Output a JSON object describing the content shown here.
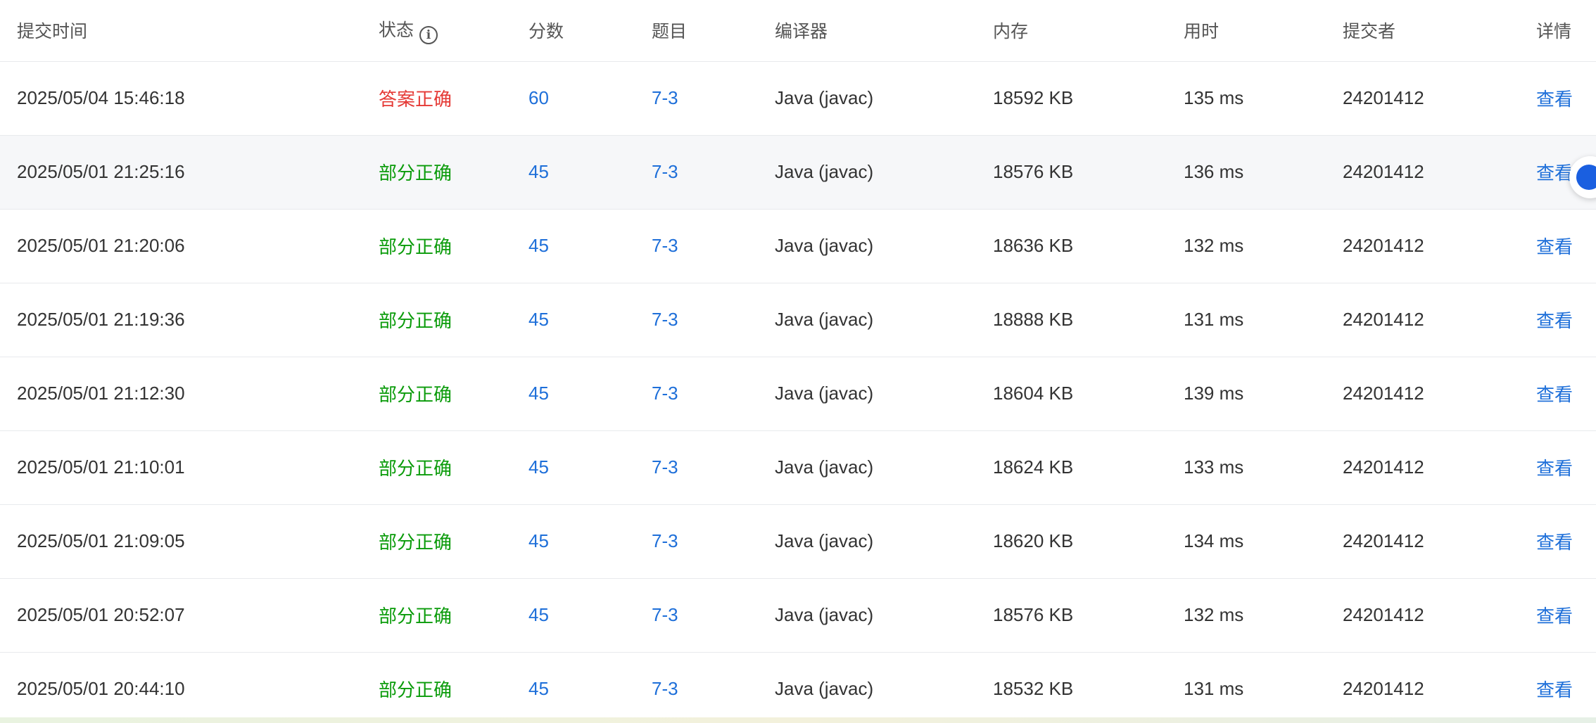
{
  "columns": {
    "time": "提交时间",
    "status": "状态",
    "score": "分数",
    "problem": "题目",
    "compiler": "编译器",
    "memory": "内存",
    "time_used": "用时",
    "submitter": "提交者",
    "detail": "详情"
  },
  "status_info_icon": "info-icon",
  "colors": {
    "accepted": "#e53935",
    "partial": "#0a9b0a",
    "link": "#1e6fd9",
    "floating_button": "#1a5fe0"
  },
  "rows": [
    {
      "time": "2025/05/04 15:46:18",
      "status": "答案正确",
      "status_type": "accepted",
      "score": "60",
      "problem": "7-3",
      "compiler": "Java (javac)",
      "memory": "18592 KB",
      "time_used": "135 ms",
      "submitter": "24201412",
      "detail": "查看"
    },
    {
      "time": "2025/05/01 21:25:16",
      "status": "部分正确",
      "status_type": "partial",
      "score": "45",
      "problem": "7-3",
      "compiler": "Java (javac)",
      "memory": "18576 KB",
      "time_used": "136 ms",
      "submitter": "24201412",
      "detail": "查看"
    },
    {
      "time": "2025/05/01 21:20:06",
      "status": "部分正确",
      "status_type": "partial",
      "score": "45",
      "problem": "7-3",
      "compiler": "Java (javac)",
      "memory": "18636 KB",
      "time_used": "132 ms",
      "submitter": "24201412",
      "detail": "查看"
    },
    {
      "time": "2025/05/01 21:19:36",
      "status": "部分正确",
      "status_type": "partial",
      "score": "45",
      "problem": "7-3",
      "compiler": "Java (javac)",
      "memory": "18888 KB",
      "time_used": "131 ms",
      "submitter": "24201412",
      "detail": "查看"
    },
    {
      "time": "2025/05/01 21:12:30",
      "status": "部分正确",
      "status_type": "partial",
      "score": "45",
      "problem": "7-3",
      "compiler": "Java (javac)",
      "memory": "18604 KB",
      "time_used": "139 ms",
      "submitter": "24201412",
      "detail": "查看"
    },
    {
      "time": "2025/05/01 21:10:01",
      "status": "部分正确",
      "status_type": "partial",
      "score": "45",
      "problem": "7-3",
      "compiler": "Java (javac)",
      "memory": "18624 KB",
      "time_used": "133 ms",
      "submitter": "24201412",
      "detail": "查看"
    },
    {
      "time": "2025/05/01 21:09:05",
      "status": "部分正确",
      "status_type": "partial",
      "score": "45",
      "problem": "7-3",
      "compiler": "Java (javac)",
      "memory": "18620 KB",
      "time_used": "134 ms",
      "submitter": "24201412",
      "detail": "查看"
    },
    {
      "time": "2025/05/01 20:52:07",
      "status": "部分正确",
      "status_type": "partial",
      "score": "45",
      "problem": "7-3",
      "compiler": "Java (javac)",
      "memory": "18576 KB",
      "time_used": "132 ms",
      "submitter": "24201412",
      "detail": "查看"
    },
    {
      "time": "2025/05/01 20:44:10",
      "status": "部分正确",
      "status_type": "partial",
      "score": "45",
      "problem": "7-3",
      "compiler": "Java (javac)",
      "memory": "18532 KB",
      "time_used": "131 ms",
      "submitter": "24201412",
      "detail": "查看"
    }
  ]
}
